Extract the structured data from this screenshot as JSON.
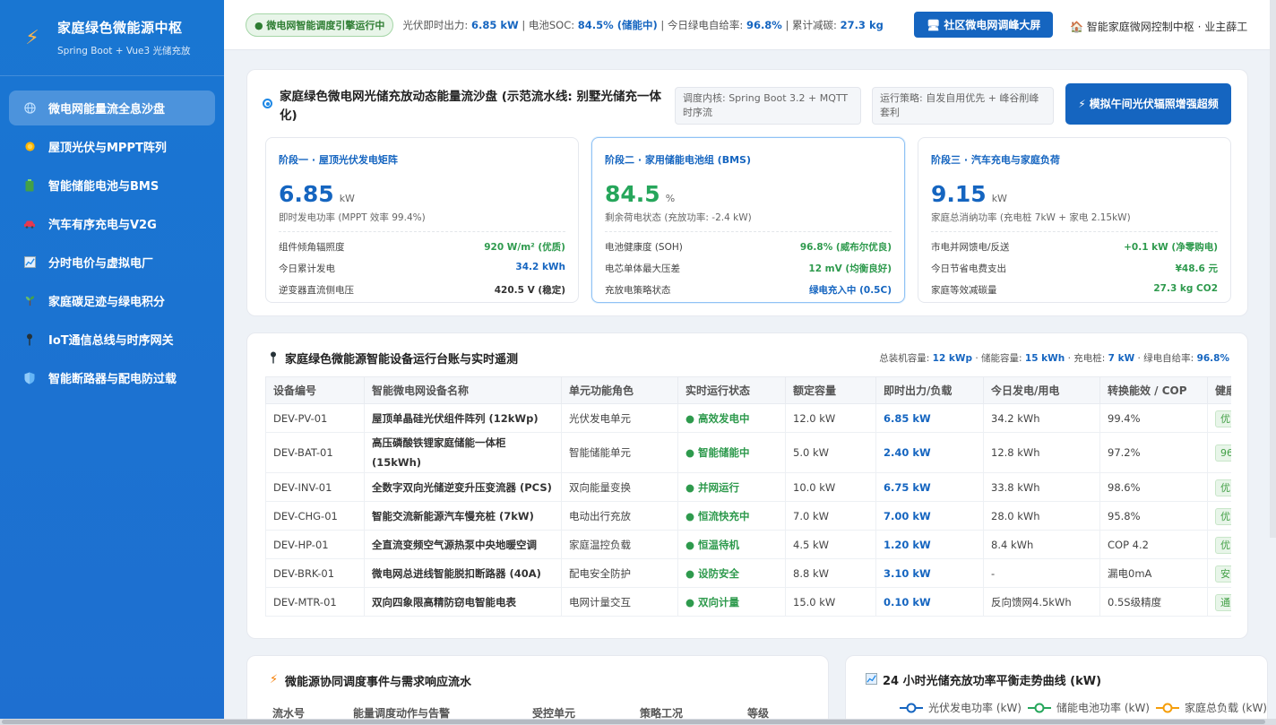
{
  "brand": {
    "title": "家庭绿色微能源中枢",
    "subtitle": "Spring Boot + Vue3 光储充放"
  },
  "sidebar": {
    "items": [
      {
        "label": "微电网能量流全息沙盘",
        "icon": "globe-icon"
      },
      {
        "label": "屋顶光伏与MPPT阵列",
        "icon": "sun-icon"
      },
      {
        "label": "智能储能电池与BMS",
        "icon": "battery-icon"
      },
      {
        "label": "汽车有序充电与V2G",
        "icon": "car-icon"
      },
      {
        "label": "分时电价与虚拟电厂",
        "icon": "chart-icon"
      },
      {
        "label": "家庭碳足迹与绿电积分",
        "icon": "seedling-icon"
      },
      {
        "label": "IoT通信总线与时序网关",
        "icon": "pin-icon"
      },
      {
        "label": "智能断路器与配电防过载",
        "icon": "shield-icon"
      }
    ]
  },
  "header": {
    "status": "● 微电网智能调度引擎运行中",
    "m1_label": "光伏即时出力:",
    "m1_value": "6.85 kW",
    "m2_label": "| 电池SOC:",
    "m2_value": "84.5% (储能中)",
    "m3_label": "| 今日绿电自给率:",
    "m3_value": "96.8%",
    "m4_label": "| 累计减碳:",
    "m4_value": "27.3 kg",
    "community_btn": "🖥 社区微电网调峰大屏",
    "user": "🏠 智能家庭微网控制中枢 · 业主薛工"
  },
  "flow": {
    "title": "家庭绿色微电网光储充放动态能量流沙盘 (示范流水线: 别墅光储充一体化)",
    "tag1": "调度内核: Spring Boot 3.2 + MQTT 时序流",
    "tag2": "运行策略: 自发自用优先 + 峰谷削峰套利",
    "sim_btn": "⚡ 模拟午间光伏辐照增强超频",
    "stages": [
      {
        "label": "阶段一 · 屋顶光伏发电矩阵",
        "value": "6.85",
        "unit": "kW",
        "desc": "即时发电功率 (MPPT 效率 99.4%)",
        "rows": [
          [
            "组件倾角辐照度",
            "920 W/m² (优质)"
          ],
          [
            "今日累计发电",
            "34.2 kWh"
          ],
          [
            "逆变器直流侧电压",
            "420.5 V (稳定)"
          ]
        ]
      },
      {
        "label": "阶段二 · 家用储能电池组 (BMS)",
        "value": "84.5",
        "unit": "%",
        "desc": "剩余荷电状态 (充放功率: -2.4 kW)",
        "rows": [
          [
            "电池健康度 (SOH)",
            "96.8% (威布尔优良)"
          ],
          [
            "电芯单体最大压差",
            "12 mV (均衡良好)"
          ],
          [
            "充放电策略状态",
            "绿电充入中 (0.5C)"
          ]
        ]
      },
      {
        "label": "阶段三 · 汽车充电与家庭负荷",
        "value": "9.15",
        "unit": "kW",
        "desc": "家庭总消纳功率 (充电桩 7kW + 家电 2.15kW)",
        "rows": [
          [
            "市电并网馈电/反送",
            "+0.1 kW (净零购电)"
          ],
          [
            "今日节省电费支出",
            "¥48.6 元"
          ],
          [
            "家庭等效减碳量",
            "27.3 kg CO2"
          ]
        ]
      }
    ]
  },
  "devices": {
    "title": "家庭绿色微能源智能设备运行台账与实时遥测",
    "summary": {
      "l1": "总装机容量:",
      "v1": "12 kWp",
      "l2": "· 储能容量:",
      "v2": "15 kWh",
      "l3": "· 充电桩:",
      "v3": "7 kW",
      "l4": "· 绿电自给率:",
      "v4": "96.8%"
    },
    "columns": [
      "设备编号",
      "智能微电网设备名称",
      "单元功能角色",
      "实时运行状态",
      "额定容量",
      "即时出力/负载",
      "今日发电/用电",
      "转换能效 / COP",
      "健康"
    ],
    "rows": [
      [
        "DEV-PV-01",
        "屋顶单晶硅光伏组件阵列 (12kWp)",
        "光伏发电单元",
        "● 高效发电中",
        "12.0 kW",
        "6.85 kW",
        "34.2 kWh",
        "99.4%",
        "优"
      ],
      [
        "DEV-BAT-01",
        "高压磷酸铁锂家庭储能一体柜 (15kWh)",
        "智能储能单元",
        "● 智能储能中",
        "5.0 kW",
        "2.40 kW",
        "12.8 kWh",
        "97.2%",
        "96"
      ],
      [
        "DEV-INV-01",
        "全数字双向光储逆变升压变流器 (PCS)",
        "双向能量变换",
        "● 并网运行",
        "10.0 kW",
        "6.75 kW",
        "33.8 kWh",
        "98.6%",
        "优"
      ],
      [
        "DEV-CHG-01",
        "智能交流新能源汽车慢充桩 (7kW)",
        "电动出行充放",
        "● 恒流快充中",
        "7.0 kW",
        "7.00 kW",
        "28.0 kWh",
        "95.8%",
        "优"
      ],
      [
        "DEV-HP-01",
        "全直流变频空气源热泵中央地暖空调",
        "家庭温控负载",
        "● 恒温待机",
        "4.5 kW",
        "1.20 kW",
        "8.4 kWh",
        "COP 4.2",
        "优"
      ],
      [
        "DEV-BRK-01",
        "微电网总进线智能脱扣断路器 (40A)",
        "配电安全防护",
        "● 设防安全",
        "8.8 kW",
        "3.10 kW",
        "-",
        "漏电0mA",
        "安"
      ],
      [
        "DEV-MTR-01",
        "双向四象限高精防窃电智能电表",
        "电网计量交互",
        "● 双向计量",
        "15.0 kW",
        "0.10 kW",
        "反向馈网4.5kWh",
        "0.5S级精度",
        "通"
      ]
    ]
  },
  "events": {
    "title": "微能源协同调度事件与需求响应流水",
    "columns": [
      "流水号",
      "能量调度动作与告警",
      "受控单元",
      "策略工况",
      "等级"
    ]
  },
  "trend": {
    "title": "24 小时光储充放功率平衡走势曲线 (kW)",
    "legend": [
      {
        "name": "光伏发电功率 (kW)",
        "color": "#1565c0"
      },
      {
        "name": "储能电池功率 (kW)",
        "color": "#26a65b"
      },
      {
        "name": "家庭总负载 (kW)",
        "color": "#f59e0b"
      }
    ]
  },
  "colors": {
    "primary": "#1565c0",
    "green": "#26a65b",
    "sidebar": "#1976d2"
  }
}
